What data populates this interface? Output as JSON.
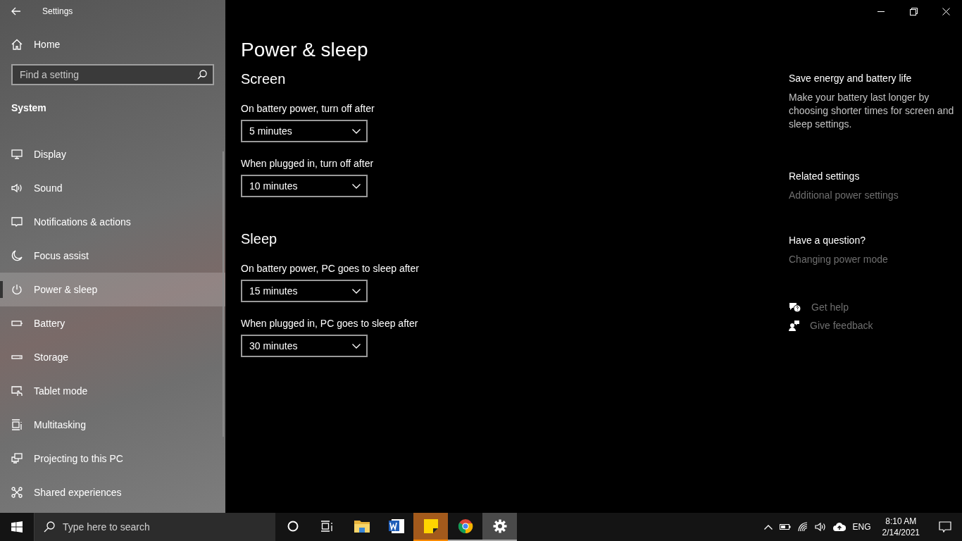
{
  "window": {
    "title": "Settings"
  },
  "sidebar": {
    "home": "Home",
    "search": {
      "placeholder": "Find a setting"
    },
    "section": "System",
    "items": [
      {
        "kind": "display",
        "label": "Display",
        "selected": false
      },
      {
        "kind": "sound",
        "label": "Sound",
        "selected": false
      },
      {
        "kind": "notifications",
        "label": "Notifications & actions",
        "selected": false
      },
      {
        "kind": "focus",
        "label": "Focus assist",
        "selected": false
      },
      {
        "kind": "power",
        "label": "Power & sleep",
        "selected": true
      },
      {
        "kind": "battery",
        "label": "Battery",
        "selected": false
      },
      {
        "kind": "storage",
        "label": "Storage",
        "selected": false
      },
      {
        "kind": "tablet",
        "label": "Tablet mode",
        "selected": false
      },
      {
        "kind": "multitasking",
        "label": "Multitasking",
        "selected": false
      },
      {
        "kind": "projecting",
        "label": "Projecting to this PC",
        "selected": false
      },
      {
        "kind": "shared",
        "label": "Shared experiences",
        "selected": false
      }
    ]
  },
  "main": {
    "title": "Power & sleep",
    "sections": [
      {
        "heading": "Screen",
        "settings": [
          {
            "label": "On battery power, turn off after",
            "value": "5 minutes"
          },
          {
            "label": "When plugged in, turn off after",
            "value": "10 minutes"
          }
        ]
      },
      {
        "heading": "Sleep",
        "settings": [
          {
            "label": "On battery power, PC goes to sleep after",
            "value": "15 minutes"
          },
          {
            "label": "When plugged in, PC goes to sleep after",
            "value": "30 minutes"
          }
        ]
      }
    ]
  },
  "aside": {
    "tip_title": "Save energy and battery life",
    "tip_text": "Make your battery last longer by choosing shorter times for screen and sleep settings.",
    "related_title": "Related settings",
    "related_link": "Additional power settings",
    "question_title": "Have a question?",
    "question_link": "Changing power mode",
    "help": [
      {
        "kind": "help",
        "label": "Get help"
      },
      {
        "kind": "feedback",
        "label": "Give feedback"
      }
    ]
  },
  "taskbar": {
    "search": {
      "placeholder": "Type here to search"
    },
    "apps": [
      {
        "kind": "explorer",
        "open": false,
        "flashing": false,
        "selected": false
      },
      {
        "kind": "word",
        "open": false,
        "flashing": false,
        "selected": false
      },
      {
        "kind": "notes",
        "open": true,
        "flashing": true,
        "selected": false
      },
      {
        "kind": "chrome",
        "open": true,
        "flashing": false,
        "selected": false
      },
      {
        "kind": "settings",
        "open": true,
        "flashing": false,
        "selected": true
      }
    ],
    "language": "ENG",
    "time": "8:10 AM",
    "date": "2/14/2021"
  }
}
